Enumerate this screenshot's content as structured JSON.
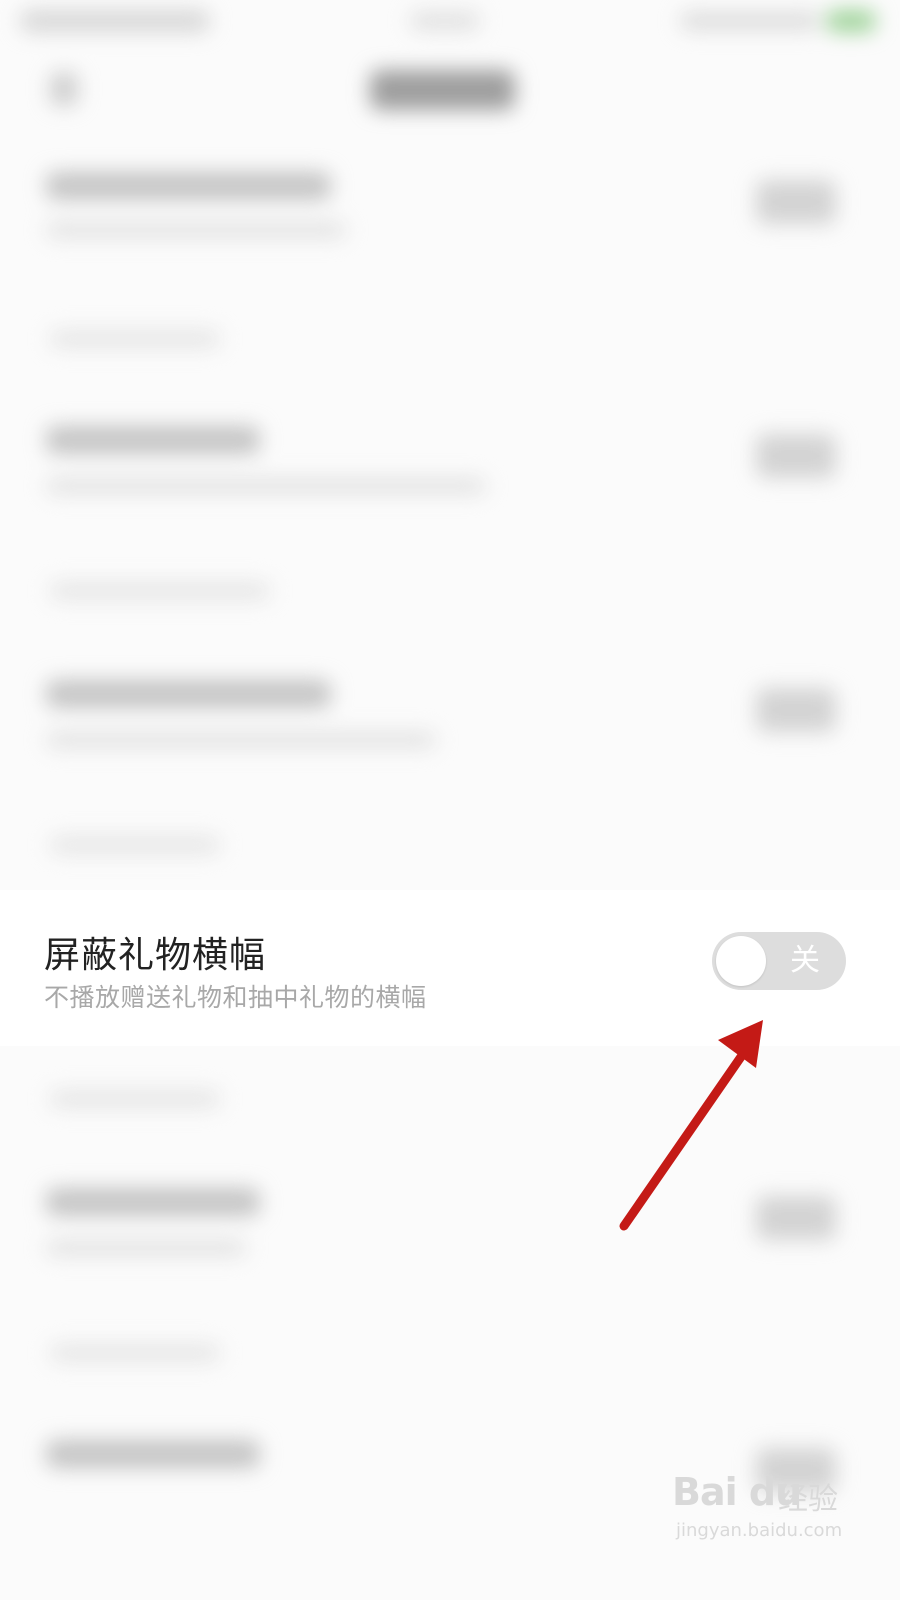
{
  "setting": {
    "title": "屏蔽礼物横幅",
    "subtitle": "不播放赠送礼物和抽中礼物的横幅",
    "toggle_label": "关",
    "toggle_state": "off"
  },
  "watermark": {
    "logo": "Bai du",
    "cn": "经验",
    "url": "jingyan.baidu.com"
  },
  "colors": {
    "annotation_arrow": "#c41a16",
    "toggle_off": "#dddddd"
  }
}
